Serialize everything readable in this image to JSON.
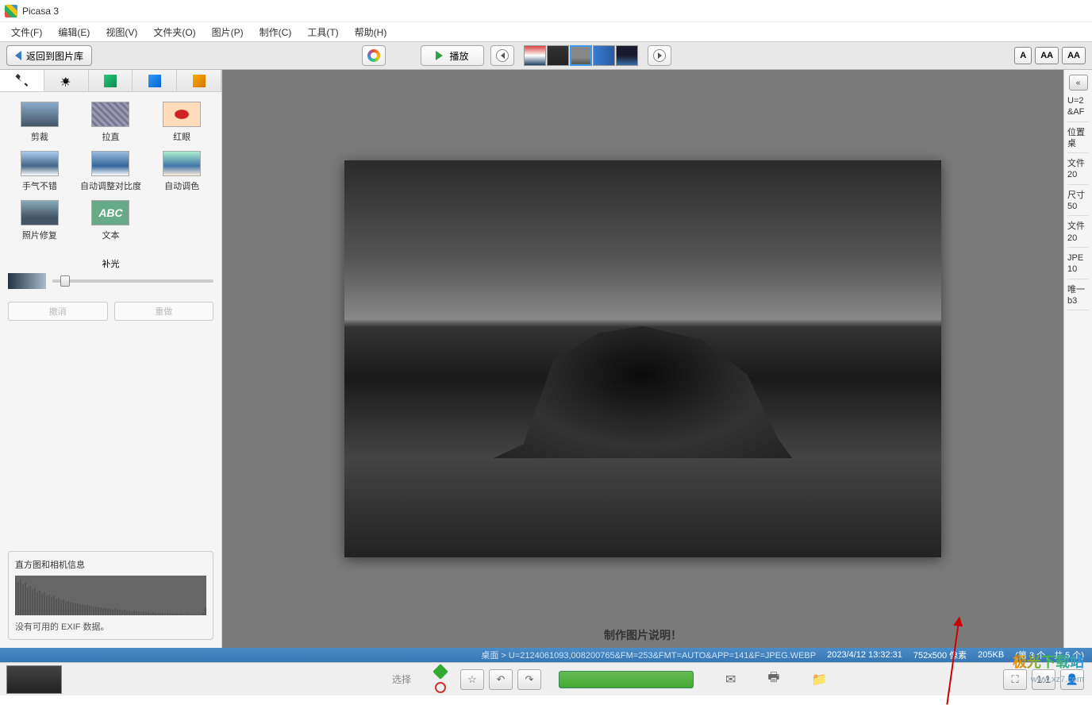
{
  "title_bar": {
    "app_name": "Picasa 3"
  },
  "menu": {
    "file": "文件(F)",
    "edit": "编辑(E)",
    "view": "视图(V)",
    "folder": "文件夹(O)",
    "picture": "图片(P)",
    "create": "制作(C)",
    "tools": "工具(T)",
    "help": "帮助(H)"
  },
  "toolbar": {
    "back_label": "返回到图片库",
    "play_label": "播放",
    "aa": [
      "A",
      "AA",
      "AA"
    ]
  },
  "edit_tools": {
    "crop": "剪裁",
    "straighten": "拉直",
    "redeye": "红眼",
    "lucky": "手气不错",
    "contrast": "自动调整对比度",
    "color": "自动调色",
    "retouch": "照片修复",
    "text": "文本",
    "text_icon": "ABC",
    "fill_light": "补光",
    "undo": "撤消",
    "redo": "重做"
  },
  "histo": {
    "title": "直方图和相机信息",
    "note": "没有可用的 EXIF 数据。"
  },
  "caption": {
    "prompt": "制作图片说明！"
  },
  "status": {
    "crumb_prefix": "桌面 >",
    "filename": "U=2124061093,008200765&FM=253&FMT=AUTO&APP=141&F=JPEG.WEBP",
    "datetime": "2023/4/12 13:32:31",
    "dimensions": "752x500 像素",
    "filesize": "205KB",
    "index": "(第 3 个，共 5 个)"
  },
  "info_panel": {
    "collapse": "«",
    "name_k": "U=2",
    "name_v": "&AF",
    "loc_k": "位置",
    "loc_v": "桌",
    "filek": "文件",
    "filev": "20",
    "sizek": "尺寸",
    "sizev": "50",
    "fsk": "文件",
    "fsv": "20",
    "jpg": "JPE",
    "jpgv": "10",
    "uid": "唯一",
    "uidv": "b3"
  },
  "bottom": {
    "select_label": "选择",
    "ratio": "1:1"
  },
  "watermark": {
    "brand": "极光下载站",
    "url": "www.xz7.com"
  }
}
